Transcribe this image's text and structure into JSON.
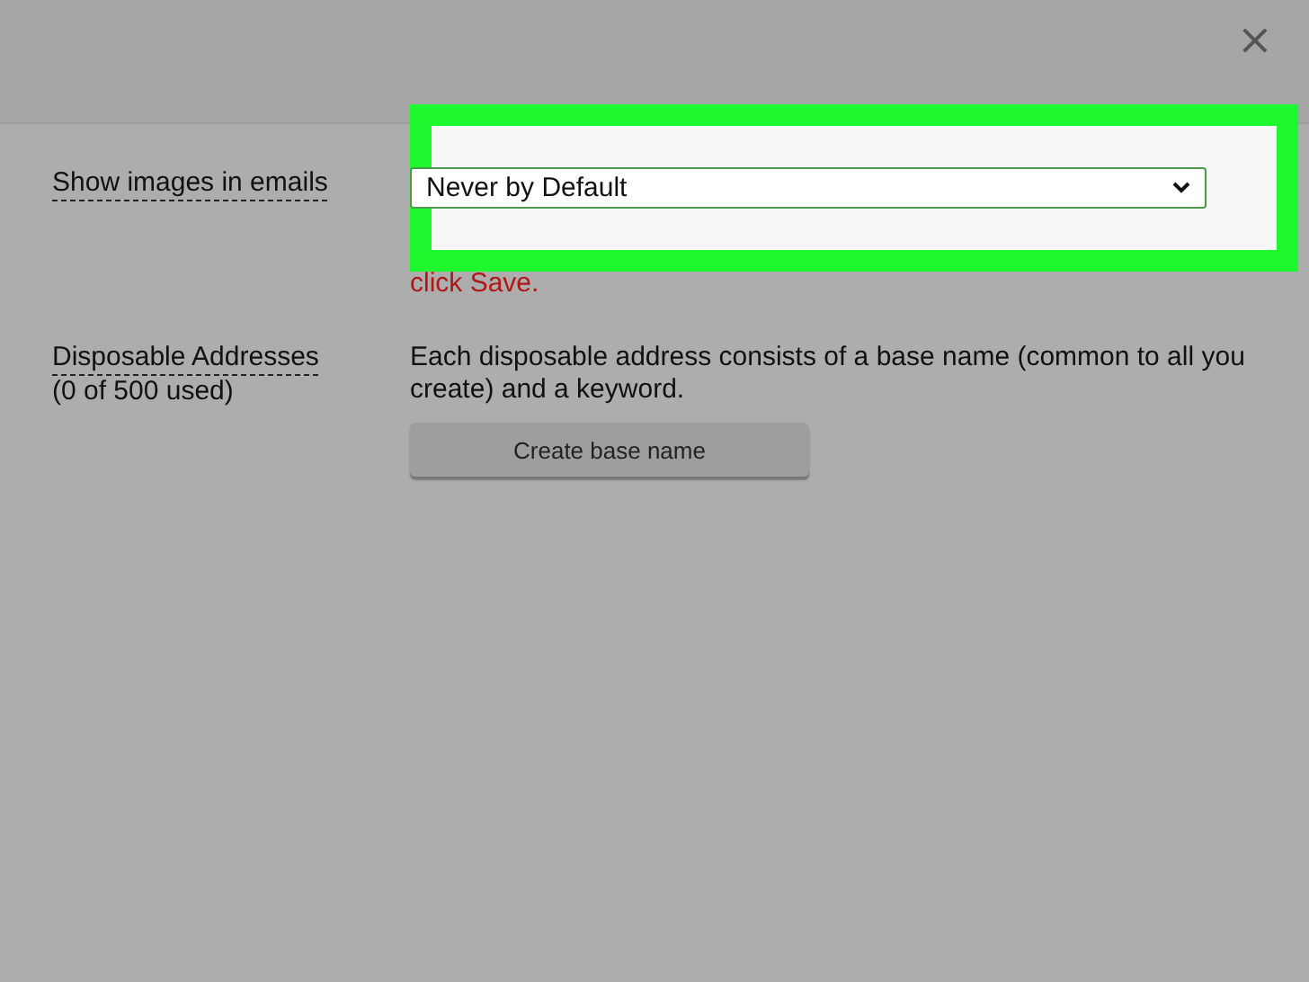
{
  "dialog": {
    "close": "×"
  },
  "images_setting": {
    "label": "Show images in emails",
    "value": "Never by Default",
    "note": "click Save.",
    "highlighted": true
  },
  "disposable_setting": {
    "label": "Disposable Addresses",
    "count": "(0 of 500 used)",
    "description": "Each disposable address consists of a base name (common to all you create) and a keyword.",
    "button": "Create base name"
  }
}
